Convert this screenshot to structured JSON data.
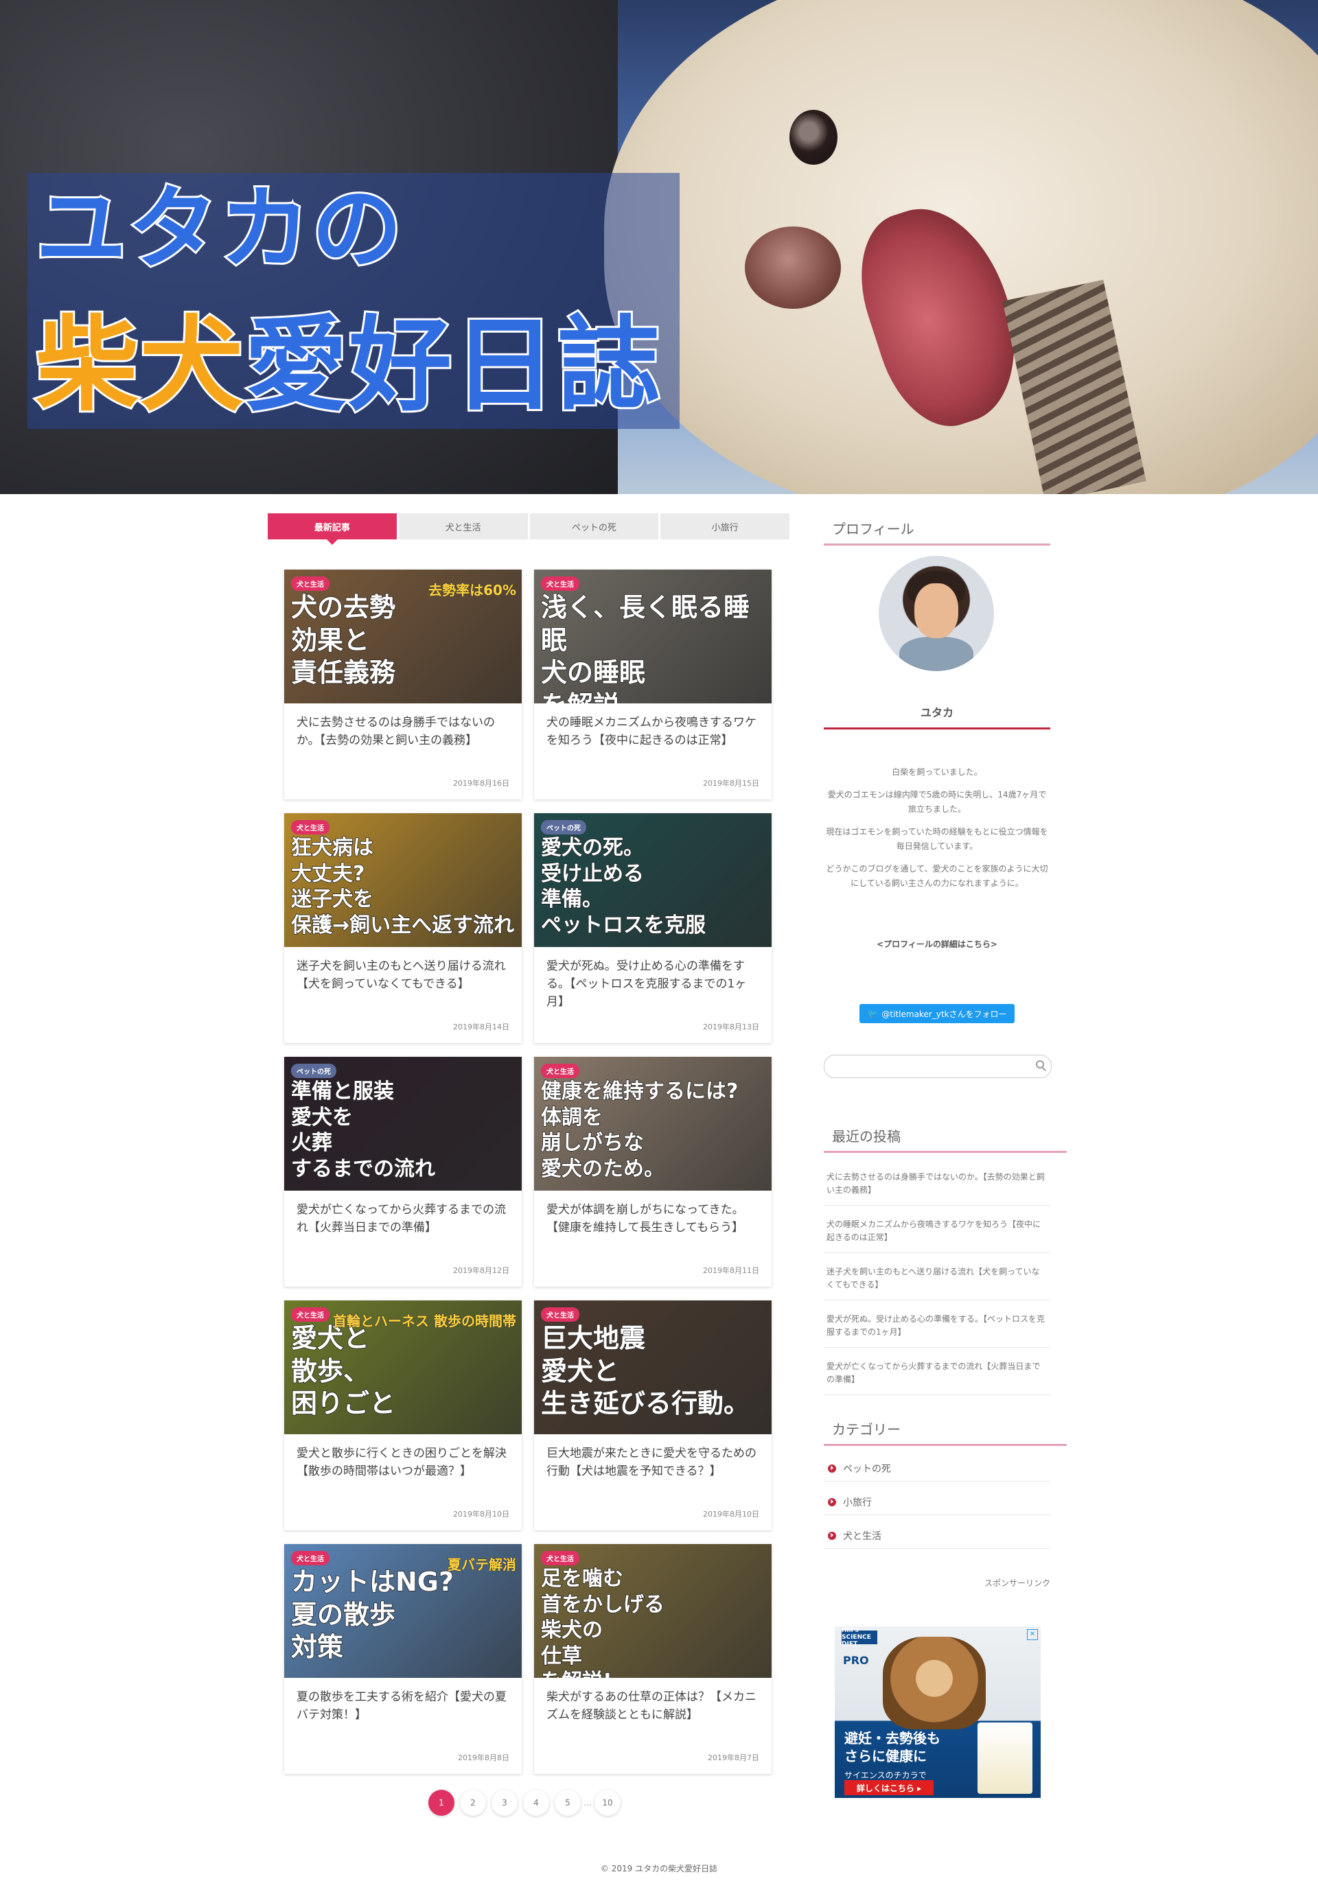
{
  "hero": {
    "title_line1": "ユタカの",
    "title_line2_orange": "柴犬",
    "title_line2_blue": "愛好日誌"
  },
  "tabs": [
    {
      "label": "最新記事",
      "active": true
    },
    {
      "label": "犬と生活",
      "active": false
    },
    {
      "label": "ペットの死",
      "active": false
    },
    {
      "label": "小旅行",
      "active": false
    }
  ],
  "articles": [
    {
      "badge": "犬と生活",
      "thumb_text": "犬の去勢\n効果と\n責任義務",
      "overlay": "去勢率は60%",
      "title": "犬に去勢させるのは身勝手ではないのか。【去勢の効果と飼い主の義務】",
      "date": "2019年8月16日",
      "bg": "#7a5a3a"
    },
    {
      "badge": "犬と生活",
      "thumb_text": "浅く、長く眠る睡眠\n犬の睡眠\nを解説。",
      "title": "犬の睡眠メカニズムから夜鳴きするワケを知ろう【夜中に起きるのは正常】",
      "date": "2019年8月15日",
      "bg": "#6e6a62"
    },
    {
      "badge": "犬と生活",
      "thumb_text": "狂犬病は\n大丈夫?\n迷子犬を\n保護→飼い主へ返す流れ",
      "title": "迷子犬を飼い主のもとへ送り届ける流れ【犬を飼っていなくてもできる】",
      "date": "2019年8月14日",
      "bg": "#b68a2a"
    },
    {
      "badge": "ペットの死",
      "thumb_text": "愛犬の死。\n受け止める\n準備。\nペットロスを克服",
      "title": "愛犬が死ぬ。受け止める心の準備をする。【ペットロスを克服するまでの1ヶ月】",
      "date": "2019年8月13日",
      "bg": "#1f4a4a"
    },
    {
      "badge": "ペットの死",
      "thumb_text": "準備と服装\n愛犬を\n火葬\nするまでの流れ",
      "title": "愛犬が亡くなってから火葬するまでの流れ【火葬当日までの準備】",
      "date": "2019年8月12日",
      "bg": "#2a1f28"
    },
    {
      "badge": "犬と生活",
      "thumb_text": "健康を維持するには?\n体調を\n崩しがちな\n愛犬のため。",
      "title": "愛犬が体調を崩しがちになってきた。【健康を維持して長生きしてもらう】",
      "date": "2019年8月11日",
      "bg": "#8a7a6a"
    },
    {
      "badge": "犬と生活",
      "thumb_text": "愛犬と\n散歩、\n困りごと",
      "overlay": "首輪とハーネス 散歩の時間帯",
      "title": "愛犬と散歩に行くときの困りごとを解決【散歩の時間帯はいつが最適？】",
      "date": "2019年8月10日",
      "bg": "#6c7a2a"
    },
    {
      "badge": "犬と生活",
      "thumb_text": "巨大地震\n愛犬と\n生き延びる行動。",
      "title": "巨大地震が来たときに愛犬を守るための行動【犬は地震を予知できる？】",
      "date": "2019年8月10日",
      "bg": "#4a3a2e"
    },
    {
      "badge": "犬と生活",
      "thumb_text": "カットはNG?\n夏の散歩\n対策",
      "overlay": "夏バテ解消",
      "title": "夏の散歩を工夫する術を紹介【愛犬の夏バテ対策！】",
      "date": "2019年8月8日",
      "bg": "#5a86b8"
    },
    {
      "badge": "犬と生活",
      "thumb_text": "足を噛む\n首をかしげる\n柴犬の\n仕草\nを解説!",
      "title": "柴犬がするあの仕草の正体は？【メカニズムを経験談とともに解説】",
      "date": "2019年8月7日",
      "bg": "#7a6a3a"
    }
  ],
  "pager": {
    "pages": [
      "1",
      "2",
      "3",
      "4",
      "5"
    ],
    "ellipsis": "…",
    "last": "10",
    "current": "1"
  },
  "sidebar": {
    "profile_heading": "プロフィール",
    "profile_name": "ユタカ",
    "profile_paragraphs": [
      "白柴を飼っていました。",
      "愛犬のゴエモンは線内障で5歳の時に失明し、14歳7ヶ月で旅立ちました。",
      "現在はゴエモンを飼っていた時の経験をもとに役立つ情報を毎日発信しています。",
      "どうかこのブログを通して、愛犬のことを家族のように大切にしている飼い主さんの力になれますように。"
    ],
    "profile_link": "<プロフィールの詳細はこちら>",
    "twitter_label": "@titlemaker_ytkさんをフォロー",
    "search_placeholder": "",
    "recent_heading": "最近の投稿",
    "recent_posts": [
      "犬に去勢させるのは身勝手ではないのか。【去勢の効果と飼い主の義務】",
      "犬の睡眠メカニズムから夜鳴きするワケを知ろう【夜中に起きるのは正常】",
      "迷子犬を飼い主のもとへ送り届ける流れ【犬を飼っていなくてもできる】",
      "愛犬が死ぬ。受け止める心の準備をする。【ペットロスを克服するまでの1ヶ月】",
      "愛犬が亡くなってから火葬するまでの流れ【火葬当日までの準備】"
    ],
    "category_heading": "カテゴリー",
    "categories": [
      "ペットの死",
      "小旅行",
      "犬と生活"
    ],
    "sponsor_label": "スポンサーリンク",
    "ad": {
      "brand": "Hill's SCIENCE DIET",
      "pro": "PRO",
      "copy": "避妊・去勢後も\nさらに健康に",
      "sub": "サイエンスのチカラで",
      "cta": "詳しくはこちら ▸",
      "close": "✕"
    }
  },
  "footer": {
    "text": "© 2019  ユタカの柴犬愛好日誌"
  },
  "colors": {
    "accent": "#e03163",
    "heading_line": "#c0283e",
    "twitter": "#1d9bf0"
  }
}
